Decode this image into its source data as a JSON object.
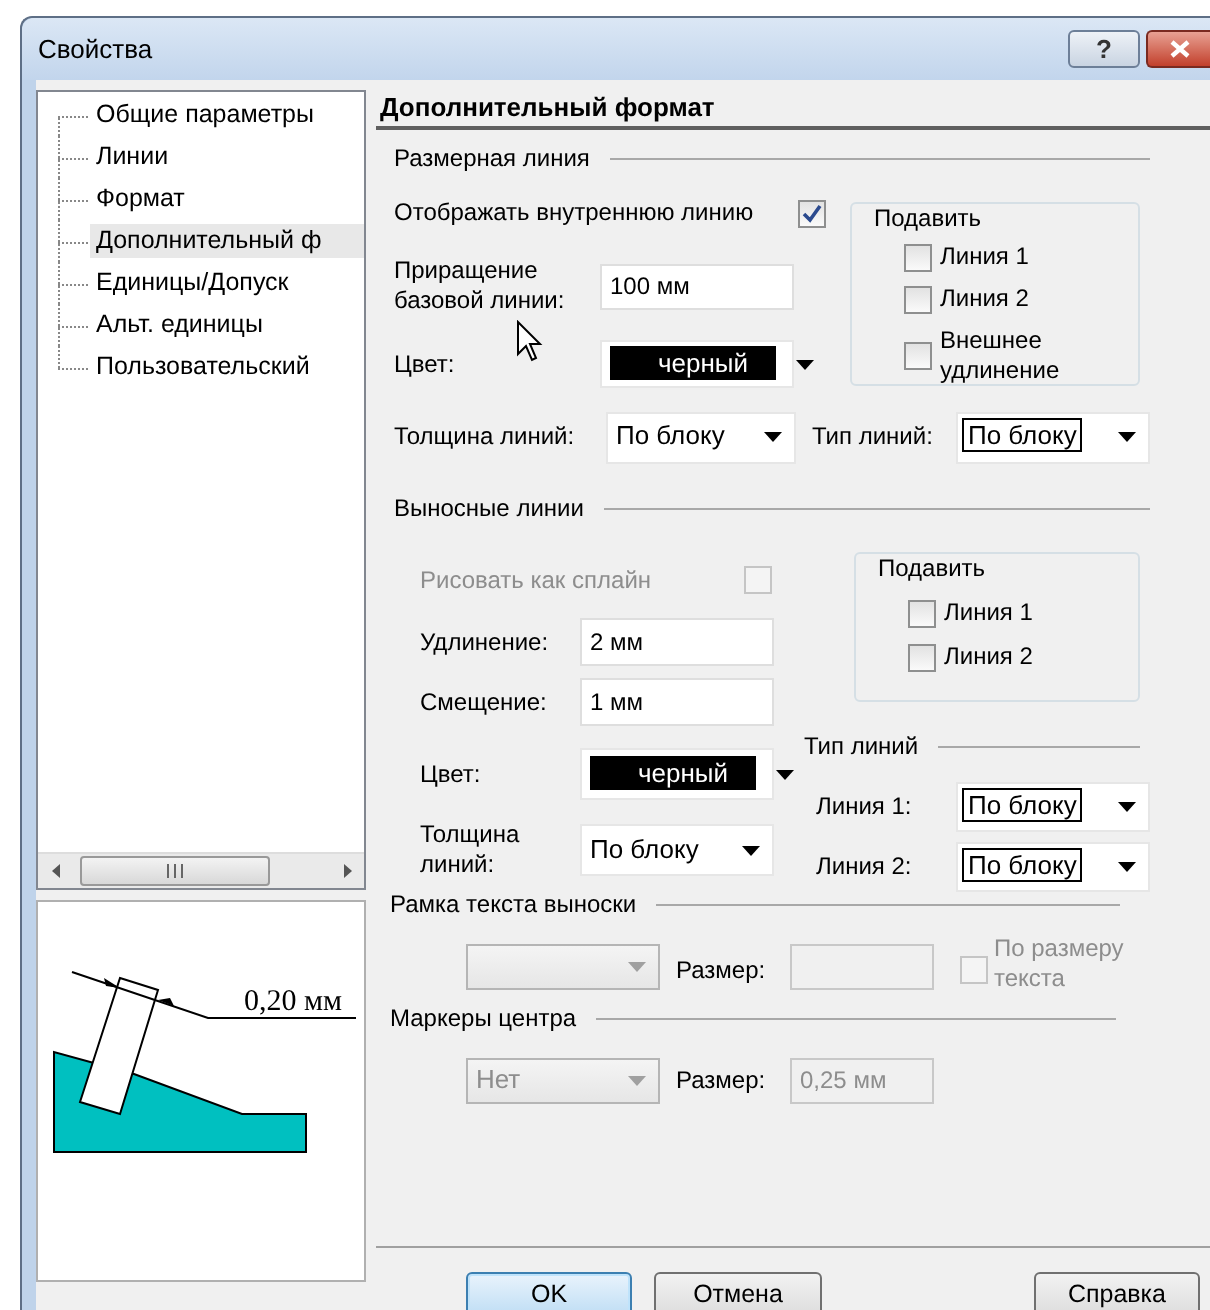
{
  "window": {
    "title": "Свойства",
    "help_button": "?"
  },
  "tree": {
    "items": [
      {
        "label": "Общие параметры",
        "selected": false
      },
      {
        "label": "Линии",
        "selected": false
      },
      {
        "label": "Формат",
        "selected": false
      },
      {
        "label": "Дополнительный ф",
        "selected": true
      },
      {
        "label": "Единицы/Допуск",
        "selected": false
      },
      {
        "label": "Альт. единицы",
        "selected": false
      },
      {
        "label": "Пользовательский",
        "selected": false
      }
    ]
  },
  "preview": {
    "dimension_label": "0,20 мм"
  },
  "panel": {
    "title": "Дополнительный формат",
    "dimension_line": {
      "title": "Размерная линия",
      "show_inner_line": {
        "label": "Отображать внутреннюю линию",
        "checked": true
      },
      "baseline_increment": {
        "label": "Приращение базовой линии:",
        "value": "100 мм"
      },
      "color": {
        "label": "Цвет:",
        "value": "черный"
      },
      "suppress": {
        "title": "Подавить",
        "options": [
          {
            "label": "Линия 1",
            "checked": false
          },
          {
            "label": "Линия 2",
            "checked": false
          },
          {
            "label": "Внешнее удлинение",
            "checked": false
          }
        ]
      },
      "lineweight": {
        "label": "Толщина линий:",
        "value": "По блоку"
      },
      "linetype": {
        "label": "Тип линий:",
        "value": "По блоку"
      }
    },
    "extension_lines": {
      "title": "Выносные линии",
      "draw_as_spline": {
        "label": "Рисовать как сплайн",
        "checked": false,
        "disabled": true
      },
      "extension": {
        "label": "Удлинение:",
        "value": "2 мм"
      },
      "offset": {
        "label": "Смещение:",
        "value": "1 мм"
      },
      "color": {
        "label": "Цвет:",
        "value": "черный"
      },
      "lineweight": {
        "label": "Толщина линий:",
        "value": "По блоку"
      },
      "suppress": {
        "title": "Подавить",
        "options": [
          {
            "label": "Линия 1",
            "checked": false
          },
          {
            "label": "Линия 2",
            "checked": false
          }
        ]
      },
      "linetypes": {
        "title": "Тип линий",
        "items": [
          {
            "label": "Линия 1:",
            "value": "По блоку"
          },
          {
            "label": "Линия 2:",
            "value": "По блоку"
          }
        ]
      }
    },
    "callout_frame": {
      "title": "Рамка текста выноски",
      "style": {
        "disabled": true
      },
      "size": {
        "label": "Размер:",
        "disabled": true
      },
      "fit_to_text": {
        "label": "По размеру текста",
        "checked": false,
        "disabled": true
      }
    },
    "center_marks": {
      "title": "Маркеры центра",
      "type": {
        "value": "Нет",
        "disabled": true
      },
      "size": {
        "label": "Размер:",
        "value": "0,25 мм",
        "disabled": true
      }
    }
  },
  "buttons": [
    {
      "label": "OK",
      "default": true
    },
    {
      "label": "Отмена",
      "default": false
    },
    {
      "label": "Справка",
      "default": false
    }
  ]
}
